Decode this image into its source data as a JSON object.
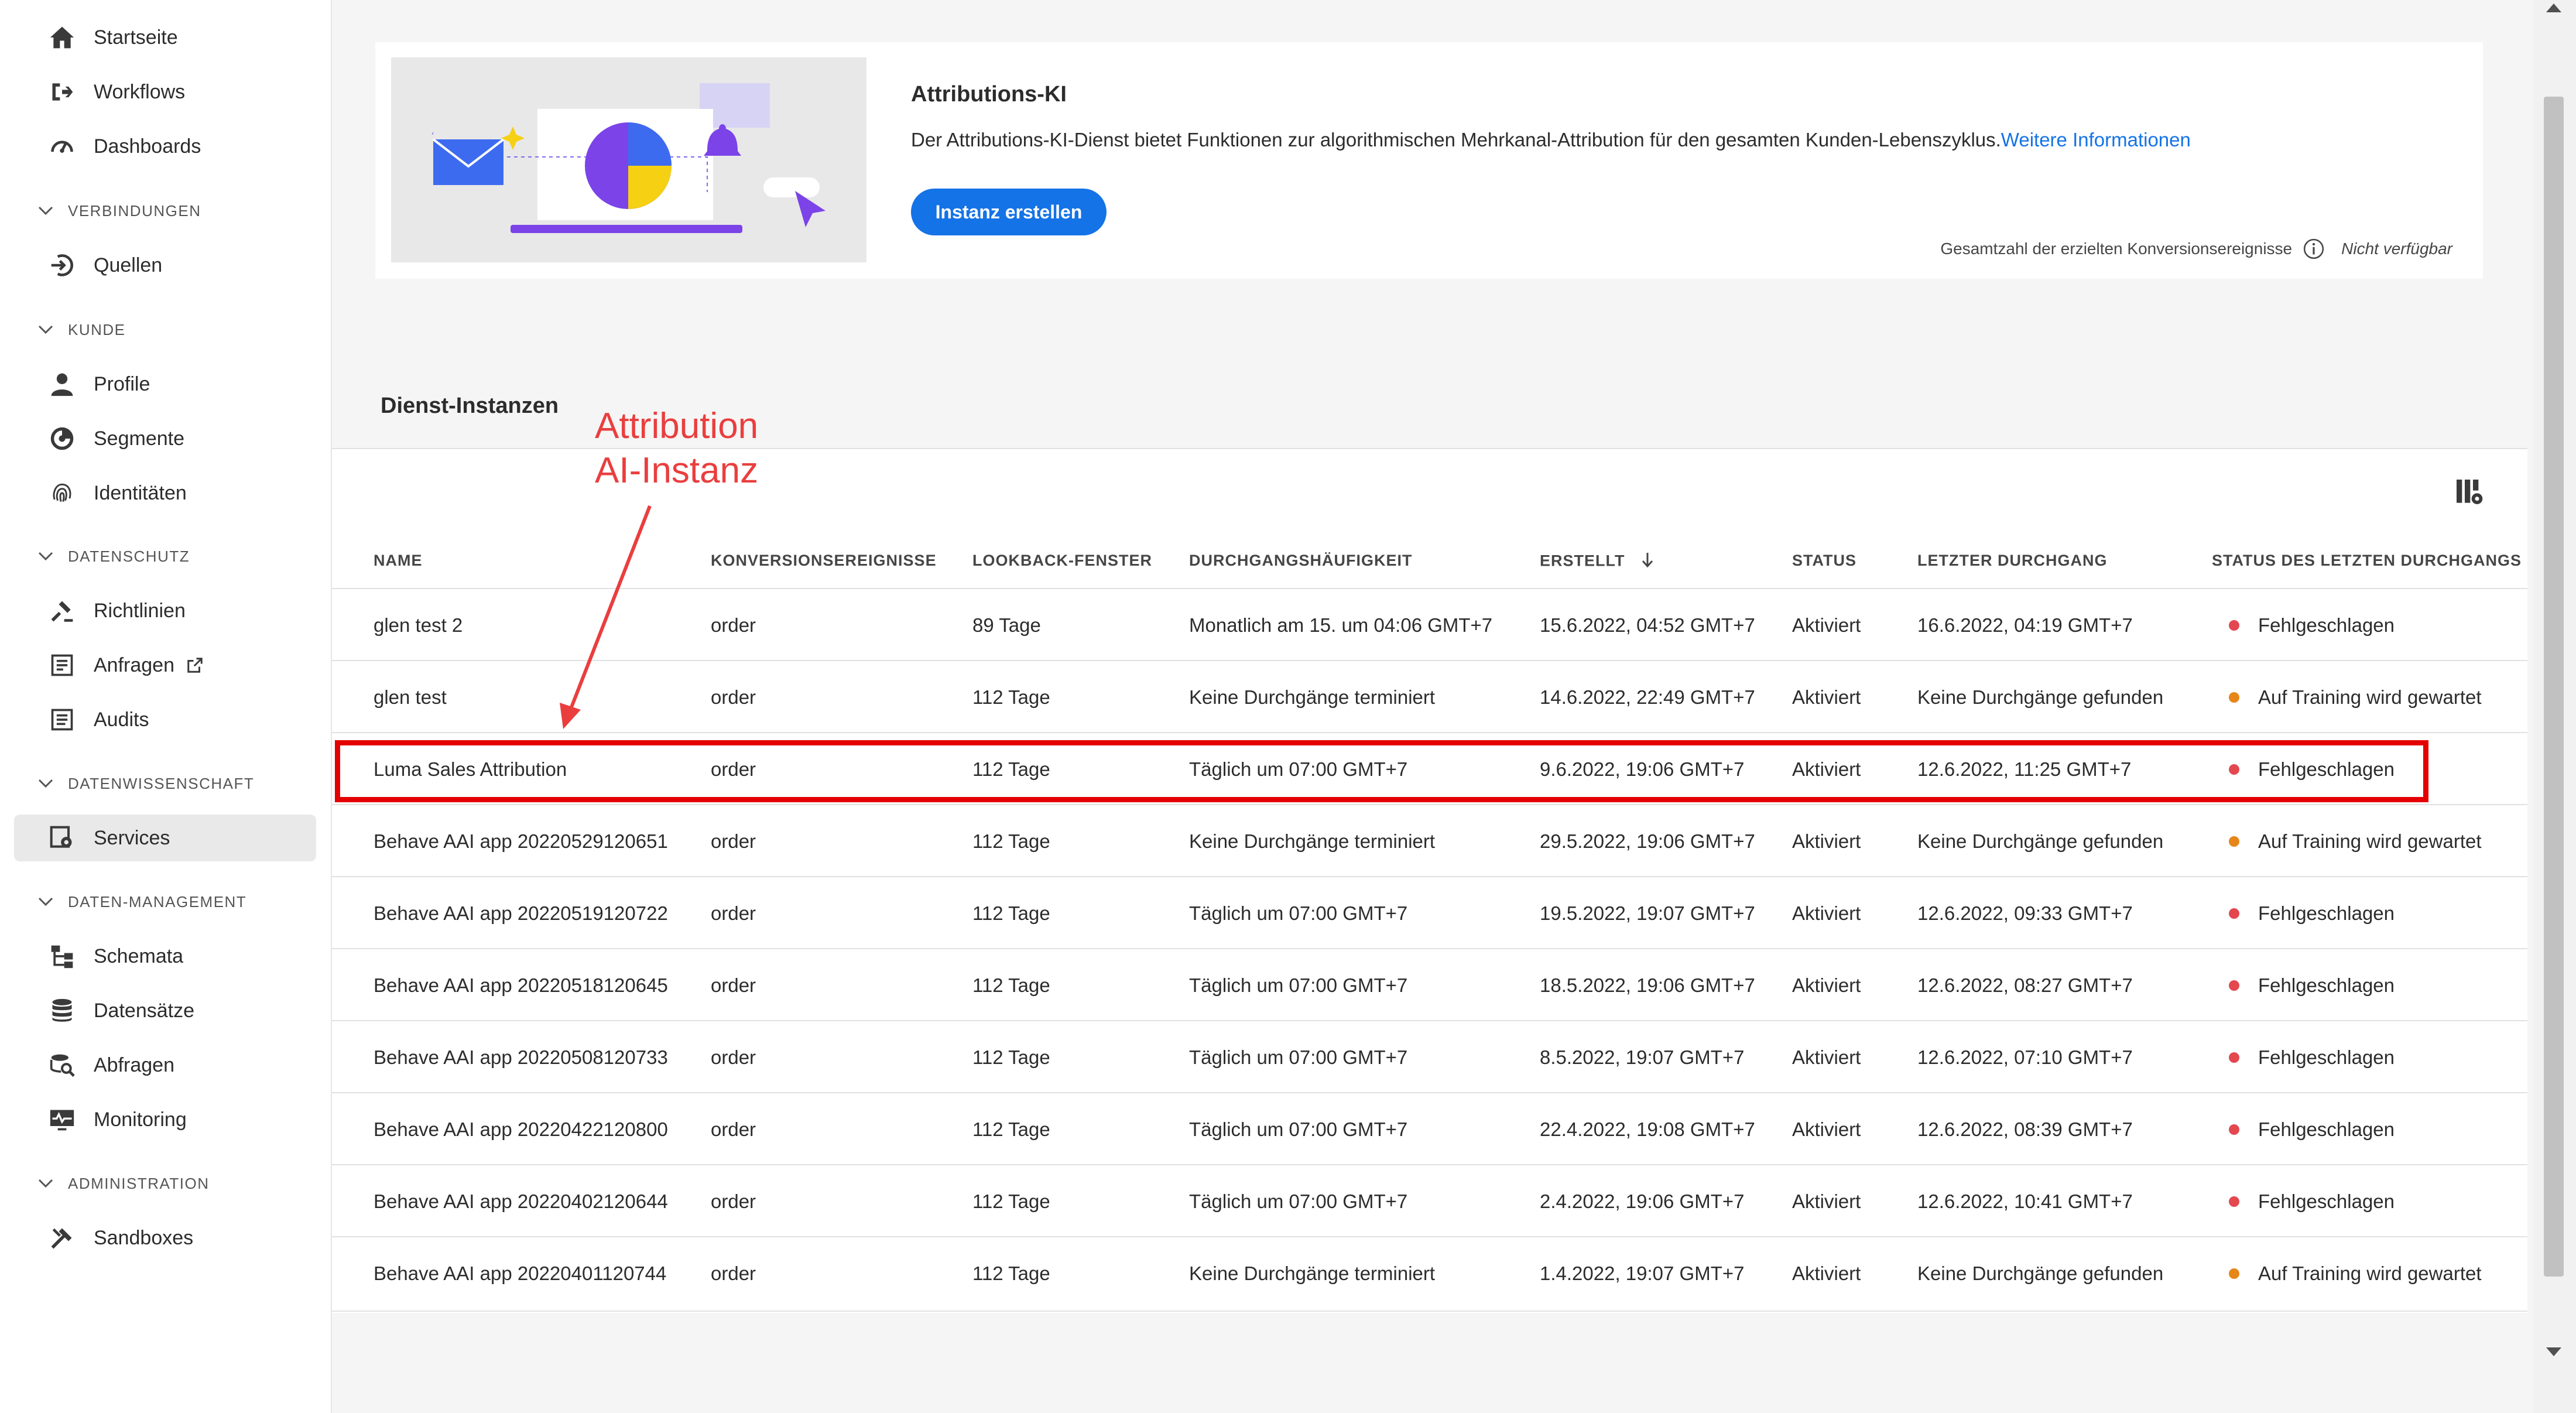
{
  "sidebar": {
    "items": [
      {
        "label": "Startseite",
        "icon": "home-icon"
      },
      {
        "label": "Workflows",
        "icon": "workflow-icon"
      },
      {
        "label": "Dashboards",
        "icon": "dashboard-icon"
      },
      {
        "label": "Quellen",
        "icon": "sources-icon"
      },
      {
        "label": "Profile",
        "icon": "user-icon"
      },
      {
        "label": "Segmente",
        "icon": "segments-icon"
      },
      {
        "label": "Identitäten",
        "icon": "fingerprint-icon"
      },
      {
        "label": "Richtlinien",
        "icon": "policy-icon"
      },
      {
        "label": "Anfragen",
        "icon": "requests-icon"
      },
      {
        "label": "Audits",
        "icon": "audits-icon"
      },
      {
        "label": "Services",
        "icon": "services-icon",
        "selected": true
      },
      {
        "label": "Schemata",
        "icon": "schema-icon"
      },
      {
        "label": "Datensätze",
        "icon": "database-icon"
      },
      {
        "label": "Abfragen",
        "icon": "queries-icon"
      },
      {
        "label": "Monitoring",
        "icon": "monitoring-icon"
      },
      {
        "label": "Sandboxes",
        "icon": "sandbox-icon"
      }
    ],
    "sections": [
      {
        "label": "VERBINDUNGEN"
      },
      {
        "label": "KUNDE"
      },
      {
        "label": "DATENSCHUTZ"
      },
      {
        "label": "DATENWISSENSCHAFT"
      },
      {
        "label": "DATEN-MANAGEMENT"
      },
      {
        "label": "ADMINISTRATION"
      }
    ]
  },
  "hero": {
    "title": "Attributions-KI",
    "description": "Der Attributions-KI-Dienst bietet Funktionen zur algorithmischen Mehrkanal-Attribution für den gesamten Kunden-Lebenszyklus.",
    "link_text": "Weitere Informationen",
    "button_label": "Instanz erstellen",
    "conversions_label": "Gesamtzahl der erzielten Konversionsereignisse",
    "conversions_value": "Nicht verfügbar"
  },
  "instances": {
    "title": "Dienst-Instanzen",
    "columns": [
      "NAME",
      "KONVERSIONSEREIGNISSE",
      "LOOKBACK-FENSTER",
      "DURCHGANGSHÄUFIGKEIT",
      "ERSTELLT",
      "STATUS",
      "LETZTER DURCHGANG",
      "STATUS DES LETZTEN DURCHGANGS"
    ],
    "sort_column": "ERSTELLT",
    "sort_direction": "descending",
    "rows": [
      {
        "name": "glen test 2",
        "conversion": "order",
        "lookback": "89 Tage",
        "frequency": "Monatlich am 15. um 04:06 GMT+7",
        "created": "15.6.2022, 04:52 GMT+7",
        "status": "Aktiviert",
        "last_run": "16.6.2022, 04:19 GMT+7",
        "last_status": "Fehlgeschlagen",
        "last_status_color": "#e34850"
      },
      {
        "name": "glen test",
        "conversion": "order",
        "lookback": "112 Tage",
        "frequency": "Keine Durchgänge terminiert",
        "created": "14.6.2022, 22:49 GMT+7",
        "status": "Aktiviert",
        "last_run": "Keine Durchgänge gefunden",
        "last_status": "Auf Training wird gewartet",
        "last_status_color": "#e68619"
      },
      {
        "name": "Luma Sales Attribution",
        "conversion": "order",
        "lookback": "112 Tage",
        "frequency": "Täglich um 07:00 GMT+7",
        "created": "9.6.2022, 19:06 GMT+7",
        "status": "Aktiviert",
        "last_run": "12.6.2022, 11:25 GMT+7",
        "last_status": "Fehlgeschlagen",
        "last_status_color": "#e34850"
      },
      {
        "name": "Behave AAI app 20220529120651",
        "conversion": "order",
        "lookback": "112 Tage",
        "frequency": "Keine Durchgänge terminiert",
        "created": "29.5.2022, 19:06 GMT+7",
        "status": "Aktiviert",
        "last_run": "Keine Durchgänge gefunden",
        "last_status": "Auf Training wird gewartet",
        "last_status_color": "#e68619"
      },
      {
        "name": "Behave AAI app 20220519120722",
        "conversion": "order",
        "lookback": "112 Tage",
        "frequency": "Täglich um 07:00 GMT+7",
        "created": "19.5.2022, 19:07 GMT+7",
        "status": "Aktiviert",
        "last_run": "12.6.2022, 09:33 GMT+7",
        "last_status": "Fehlgeschlagen",
        "last_status_color": "#e34850"
      },
      {
        "name": "Behave AAI app 20220518120645",
        "conversion": "order",
        "lookback": "112 Tage",
        "frequency": "Täglich um 07:00 GMT+7",
        "created": "18.5.2022, 19:06 GMT+7",
        "status": "Aktiviert",
        "last_run": "12.6.2022, 08:27 GMT+7",
        "last_status": "Fehlgeschlagen",
        "last_status_color": "#e34850"
      },
      {
        "name": "Behave AAI app 20220508120733",
        "conversion": "order",
        "lookback": "112 Tage",
        "frequency": "Täglich um 07:00 GMT+7",
        "created": "8.5.2022, 19:07 GMT+7",
        "status": "Aktiviert",
        "last_run": "12.6.2022, 07:10 GMT+7",
        "last_status": "Fehlgeschlagen",
        "last_status_color": "#e34850"
      },
      {
        "name": "Behave AAI app 20220422120800",
        "conversion": "order",
        "lookback": "112 Tage",
        "frequency": "Täglich um 07:00 GMT+7",
        "created": "22.4.2022, 19:08 GMT+7",
        "status": "Aktiviert",
        "last_run": "12.6.2022, 08:39 GMT+7",
        "last_status": "Fehlgeschlagen",
        "last_status_color": "#e34850"
      },
      {
        "name": "Behave AAI app 20220402120644",
        "conversion": "order",
        "lookback": "112 Tage",
        "frequency": "Täglich um 07:00 GMT+7",
        "created": "2.4.2022, 19:06 GMT+7",
        "status": "Aktiviert",
        "last_run": "12.6.2022, 10:41 GMT+7",
        "last_status": "Fehlgeschlagen",
        "last_status_color": "#e34850"
      },
      {
        "name": "Behave AAI app 20220401120744",
        "conversion": "order",
        "lookback": "112 Tage",
        "frequency": "Keine Durchgänge terminiert",
        "created": "1.4.2022, 19:07 GMT+7",
        "status": "Aktiviert",
        "last_run": "Keine Durchgänge gefunden",
        "last_status": "Auf Training wird gewartet",
        "last_status_color": "#e68619"
      }
    ]
  },
  "annotation": {
    "text": "Attribution\nAI-Instanz",
    "color": "#ea3e3e",
    "highlighted_row": "Luma Sales Attribution"
  },
  "colors": {
    "accent": "#1473e6",
    "failed": "#e34850",
    "waiting": "#e68619"
  }
}
